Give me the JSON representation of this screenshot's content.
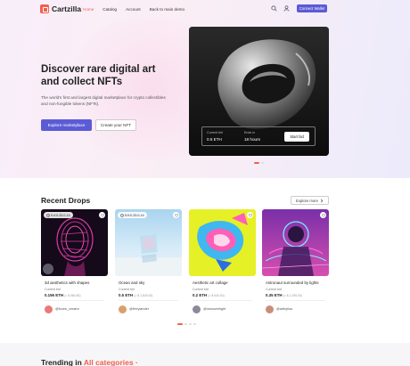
{
  "header": {
    "logo": "Cartzilla",
    "nav": [
      "Home",
      "Catalog",
      "Account",
      "Back to main demo"
    ],
    "connect_label": "Connect Wallet"
  },
  "hero": {
    "title": "Discover rare digital art and collect NFTs",
    "description": "The world's first and largest digital marketplace for crypto collectibles and non-fungible tokens (NFTs).",
    "explore_label": "Explore marketplace",
    "create_label": "Create your NFT",
    "auction": {
      "bid_label": "Current bid",
      "bid_value": "0.5 ETH",
      "ends_label": "Ends in",
      "ends_value": "18 hours",
      "button_label": "Start bid"
    }
  },
  "drops": {
    "title": "Recent Drops",
    "explore_more": "Explore more",
    "cards": [
      {
        "timer": "0:4:0-33-0-14",
        "name": "3d aesthetics with shapes",
        "bid_label": "Current bid",
        "price": "0.156 ETH",
        "usd": "(≈ $ 584.80)",
        "creator": "@foxes_creator",
        "avatar_color": "#e87a7a"
      },
      {
        "timer": "5:0:0-33-0-14",
        "name": "Ocean and sky",
        "bid_label": "Current bid",
        "price": "0.5 ETH",
        "usd": "(≈ $ 1,840.00)",
        "creator": "@ferrylander",
        "avatar_color": "#d9a06b"
      },
      {
        "timer": "",
        "name": "Aesthetic art collage",
        "bid_label": "Current bid",
        "price": "0.2 ETH",
        "usd": "(≈ $ 640.00)",
        "creator": "@newuzerlight",
        "avatar_color": "#8a8a9a"
      },
      {
        "timer": "",
        "name": "Astronaut surrounded by lights",
        "bid_label": "Current bid",
        "price": "0.35 ETH",
        "usd": "(≈ $ 1,205.00)",
        "creator": "@artbylisa",
        "avatar_color": "#c98e7a"
      }
    ]
  },
  "trending": {
    "prefix": "Trending in",
    "accent": "All categories",
    "suffix": "·"
  },
  "colors": {
    "accent": "#f25f4c",
    "primary": "#5b5bd6"
  },
  "icons": [
    "logo-icon",
    "search-icon",
    "user-icon",
    "clock-icon",
    "heart-icon",
    "chevron-right-icon"
  ]
}
